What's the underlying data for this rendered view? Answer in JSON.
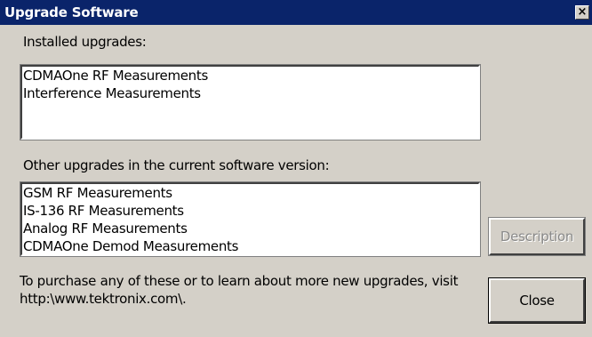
{
  "window": {
    "title": "Upgrade Software",
    "close_glyph": "×",
    "close_icon": "close-icon"
  },
  "installed": {
    "label": "Installed upgrades:",
    "items": [
      "CDMAOne RF Measurements",
      "Interference Measurements"
    ]
  },
  "other": {
    "label": "Other upgrades in the current software version:",
    "items": [
      "GSM RF Measurements",
      "IS-136 RF Measurements",
      "Analog RF Measurements",
      "CDMAOne Demod Measurements"
    ]
  },
  "buttons": {
    "description_label": "Description",
    "close_label": "Close"
  },
  "footer": {
    "line1": "To purchase any of these or to learn about more new upgrades, visit",
    "line2": "http:\\www.tektronix.com\\."
  },
  "colors": {
    "titlebar": "#0a246a",
    "dialog_bg": "#d4d0c8",
    "list_bg": "#ffffff"
  }
}
